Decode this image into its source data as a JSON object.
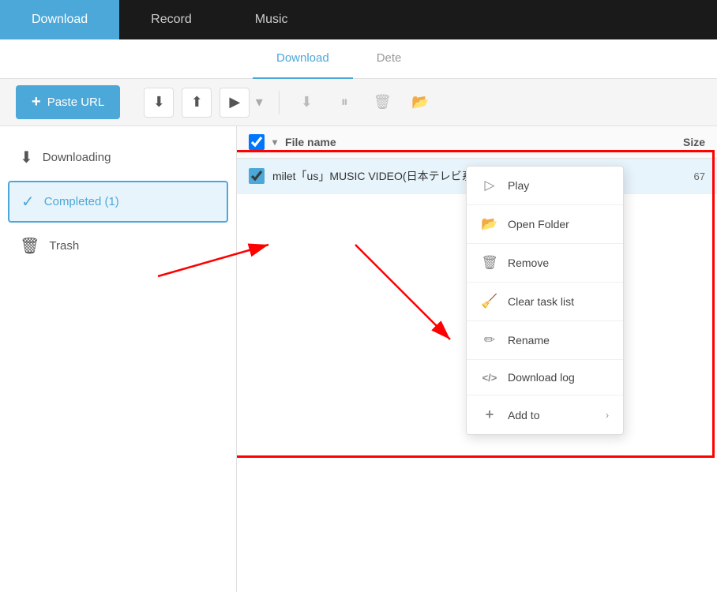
{
  "topNav": {
    "items": [
      {
        "label": "Download",
        "active": true
      },
      {
        "label": "Record",
        "active": false
      },
      {
        "label": "Music",
        "active": false
      }
    ]
  },
  "subNav": {
    "items": [
      {
        "label": "Download",
        "active": true
      },
      {
        "label": "Dete",
        "active": false
      }
    ]
  },
  "toolbar": {
    "pasteUrlLabel": "Paste URL",
    "plusSymbol": "+"
  },
  "sidebar": {
    "items": [
      {
        "label": "Downloading",
        "icon": "⬇",
        "active": false,
        "id": "downloading"
      },
      {
        "label": "Completed (1)",
        "icon": "✓",
        "active": true,
        "id": "completed"
      },
      {
        "label": "Trash",
        "icon": "🗑",
        "active": false,
        "id": "trash"
      }
    ]
  },
  "fileList": {
    "headers": {
      "name": "File name",
      "size": "Size"
    },
    "rows": [
      {
        "name": "milet「us」MUSIC VIDEO(日本テレビ系水曜ドラマ『偽装...",
        "size": "67"
      }
    ]
  },
  "contextMenu": {
    "items": [
      {
        "label": "Play",
        "icon": "▷",
        "hasArrow": false
      },
      {
        "label": "Open Folder",
        "icon": "📂",
        "hasArrow": false
      },
      {
        "label": "Remove",
        "icon": "🗑",
        "hasArrow": false
      },
      {
        "label": "Clear task list",
        "icon": "🧹",
        "hasArrow": false
      },
      {
        "label": "Rename",
        "icon": "✏",
        "hasArrow": false
      },
      {
        "label": "Download log",
        "icon": "</>",
        "hasArrow": false
      },
      {
        "label": "Add to",
        "icon": "+",
        "hasArrow": true
      }
    ]
  }
}
